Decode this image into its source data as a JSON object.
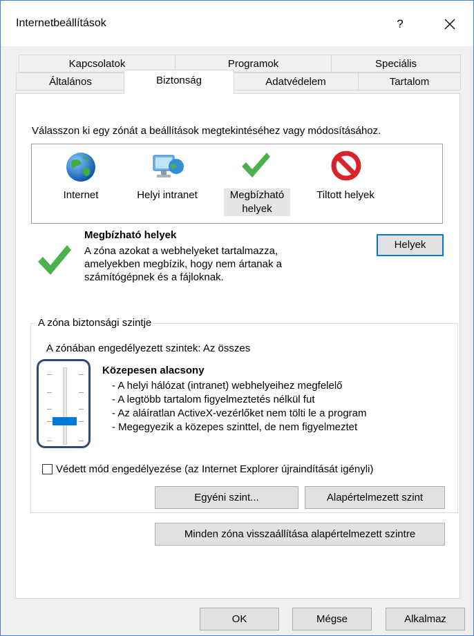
{
  "window": {
    "title": "Internetbeállítások",
    "help_label": "?",
    "close_label": "×"
  },
  "tabs": {
    "row1": [
      "Kapcsolatok",
      "Programok",
      "Speciális"
    ],
    "row2": [
      "Általános",
      "Biztonság",
      "Adatvédelem",
      "Tartalom"
    ],
    "active": "Biztonság"
  },
  "security": {
    "instruction": "Válasszon ki egy zónát a beállítások megtekintéséhez vagy módosításához.",
    "zones": [
      {
        "label": "Internet",
        "icon": "globe-icon"
      },
      {
        "label": "Helyi intranet",
        "icon": "intranet-icon"
      },
      {
        "label_line1": "Megbízható",
        "label_line2": "helyek",
        "icon": "checkmark-icon",
        "selected": true
      },
      {
        "label": "Tiltott helyek",
        "icon": "blocked-icon"
      }
    ],
    "selected_zone": {
      "title": "Megbízható helyek",
      "desc_lines": [
        "A zóna azokat a webhelyeket tartalmazza,",
        "amelyekben megbízik, hogy nem ártanak a",
        "számítógépnek és a fájloknak."
      ],
      "sites_button": "Helyek"
    },
    "level_group": {
      "label": "A zóna biztonsági szintje",
      "allowed_levels": "A zónában engedélyezett szintek: Az összes",
      "level_name": "Közepesen alacsony",
      "bullets": [
        "- A helyi hálózat (intranet) webhelyeihez megfelelő",
        "- A legtöbb tartalom figyelmeztetés nélkül fut",
        "- Az aláíratlan ActiveX-vezérlőket nem tölti le a program",
        "- Megegyezik a közepes szinttel, de nem figyelmeztet"
      ],
      "slider_level": "2 of 5",
      "protected_mode_label": "Védett mód engedélyezése (az Internet Explorer újraindítását igényli)",
      "protected_mode_checked": false,
      "custom_level_button": "Egyéni szint...",
      "default_level_button": "Alapértelmezett szint"
    },
    "reset_all_button": "Minden zóna visszaállítása alapértelmezett szintre"
  },
  "footer": {
    "ok": "OK",
    "cancel": "Mégse",
    "apply": "Alkalmaz"
  },
  "colors": {
    "accent": "#0078d7",
    "highlight_box": "#2e4a72",
    "check_green": "#4cb04c",
    "block_red": "#d8232a"
  }
}
